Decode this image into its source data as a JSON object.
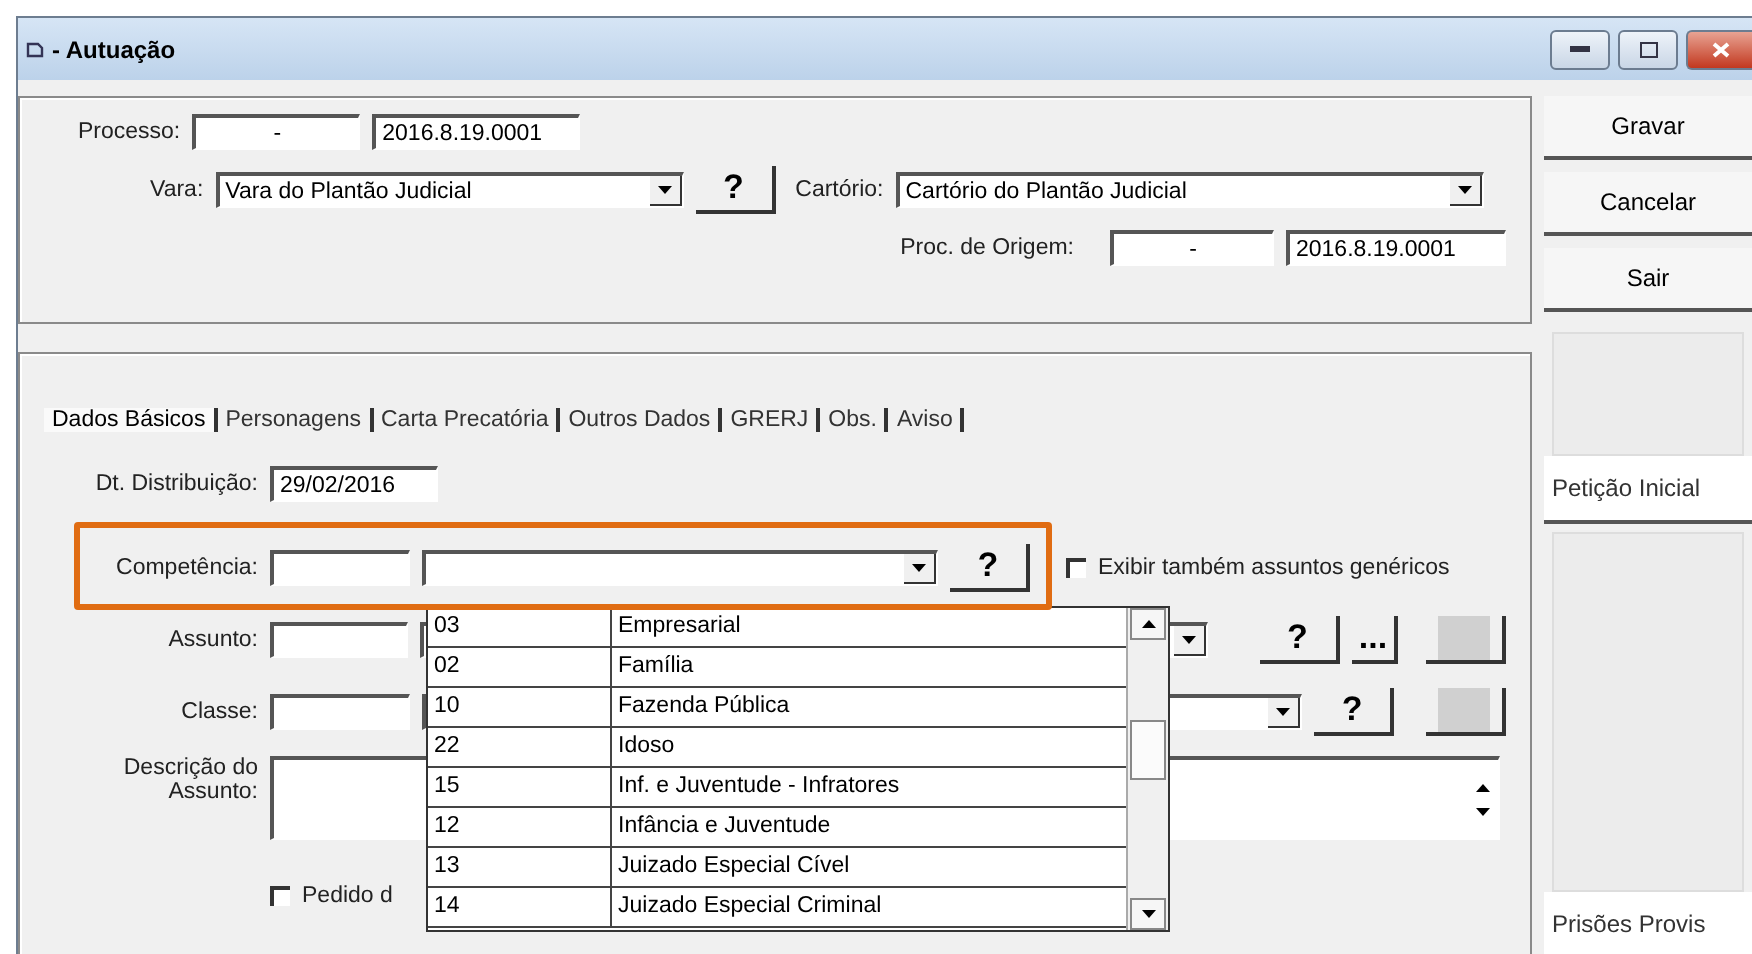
{
  "window": {
    "title": "- Autuação"
  },
  "header": {
    "processo_label": "Processo:",
    "processo_prefix": "-",
    "processo_number": "2016.8.19.0001",
    "vara_label": "Vara:",
    "vara_value": "Vara do Plantão Judicial",
    "vara_help": "?",
    "cartorio_label": "Cartório:",
    "cartorio_value": "Cartório do Plantão Judicial",
    "origem_label": "Proc. de Origem:",
    "origem_prefix": "-",
    "origem_number": "2016.8.19.0001"
  },
  "actions": [
    "Gravar",
    "Cancelar",
    "Sair"
  ],
  "tabs": [
    {
      "label": "Dados Básicos",
      "selected": true
    },
    {
      "label": "Personagens",
      "selected": false
    },
    {
      "label": "Carta Precatória",
      "selected": false
    },
    {
      "label": "Outros Dados",
      "selected": false
    },
    {
      "label": "GRERJ",
      "selected": false
    },
    {
      "label": "Obs.",
      "selected": false
    },
    {
      "label": "Aviso",
      "selected": false
    }
  ],
  "form": {
    "distribuicao_label": "Dt. Distribuição:",
    "distribuicao_value": "29/02/2016",
    "competencia_label": "Competência:",
    "competencia_help": "?",
    "generic_subjects": {
      "label": "Exibir também assuntos genéricos",
      "checked": false
    },
    "assunto_label": "Assunto:",
    "assunto_help": "?",
    "assunto_more": "...",
    "classe_label": "Classe:",
    "classe_help": "?",
    "descricao_label": "Descrição do Assunto:",
    "pedido": {
      "label": "Pedido d",
      "checked": false
    }
  },
  "dropdown": {
    "rows": [
      {
        "code": "03",
        "name": "Empresarial"
      },
      {
        "code": "02",
        "name": "Família"
      },
      {
        "code": "10",
        "name": "Fazenda Pública"
      },
      {
        "code": "22",
        "name": "Idoso"
      },
      {
        "code": "15",
        "name": "Inf. e Juventude - Infratores"
      },
      {
        "code": "12",
        "name": "Infância e Juventude"
      },
      {
        "code": "13",
        "name": "Juizado Especial Cível"
      },
      {
        "code": "14",
        "name": "Juizado Especial Criminal"
      }
    ]
  },
  "side_tabs": [
    "Petição Inicial",
    "Prisões Provis"
  ]
}
